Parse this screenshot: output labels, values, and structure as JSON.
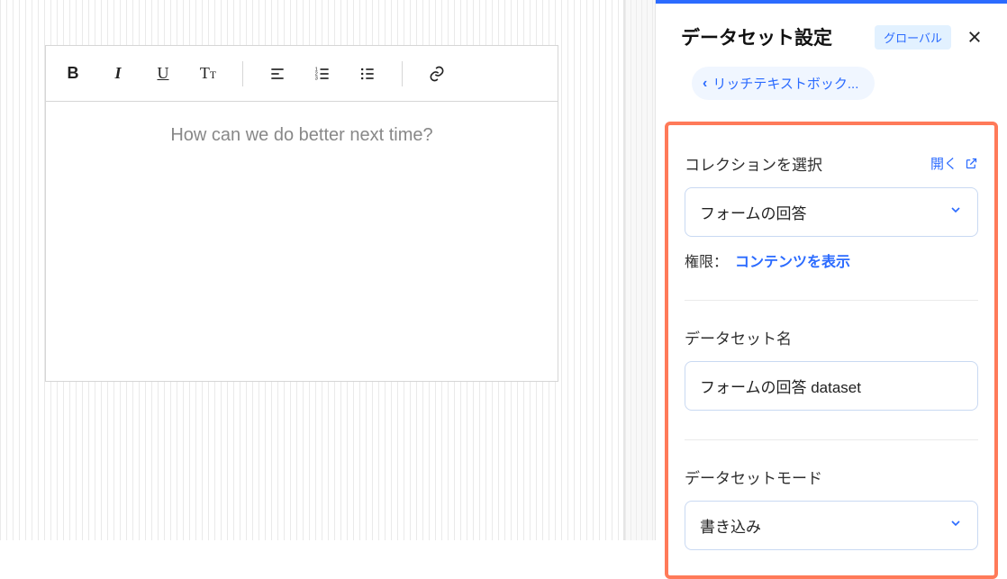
{
  "editor": {
    "placeholder": "How can we do better next time?"
  },
  "panel": {
    "title": "データセット設定",
    "badge": "グローバル",
    "breadcrumb": "リッチテキストボック...",
    "sections": {
      "collection": {
        "label": "コレクションを選択",
        "open": "開く",
        "value": "フォームの回答",
        "perm_label": "権限：",
        "perm_link": "コンテンツを表示"
      },
      "name": {
        "label": "データセット名",
        "value": "フォームの回答 dataset"
      },
      "mode": {
        "label": "データセットモード",
        "value": "書き込み"
      }
    }
  }
}
